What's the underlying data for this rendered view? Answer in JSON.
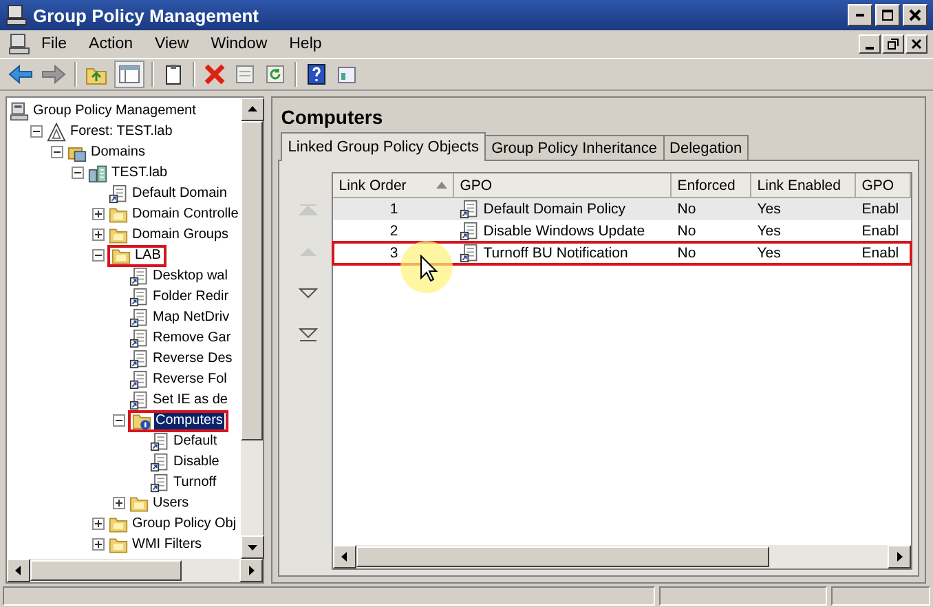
{
  "window": {
    "title": "Group Policy Management"
  },
  "menu": [
    "File",
    "Action",
    "View",
    "Window",
    "Help"
  ],
  "tree": [
    {
      "label": "Group Policy Management",
      "kind": "root",
      "selected": false,
      "highlighted": false,
      "children": [
        {
          "label": "Forest: TEST.lab",
          "kind": "forest",
          "expanded": true,
          "selected": false,
          "highlighted": false,
          "children": [
            {
              "label": "Domains",
              "kind": "domains",
              "expanded": true,
              "selected": false,
              "highlighted": false,
              "children": [
                {
                  "label": "TEST.lab",
                  "kind": "domain",
                  "expanded": true,
                  "selected": false,
                  "highlighted": false,
                  "children": [
                    {
                      "label": "Default Domain",
                      "kind": "gpo",
                      "selected": false,
                      "highlighted": false
                    },
                    {
                      "label": "Domain Controlle",
                      "kind": "folder",
                      "expanded": false,
                      "selected": false,
                      "highlighted": false
                    },
                    {
                      "label": "Domain Groups",
                      "kind": "folder",
                      "expanded": false,
                      "selected": false,
                      "highlighted": false
                    },
                    {
                      "label": "LAB",
                      "kind": "folder",
                      "expanded": true,
                      "selected": false,
                      "highlighted": true,
                      "children": [
                        {
                          "label": "Desktop wal",
                          "kind": "gpo",
                          "selected": false,
                          "highlighted": false
                        },
                        {
                          "label": "Folder Redir",
                          "kind": "gpo",
                          "selected": false,
                          "highlighted": false
                        },
                        {
                          "label": "Map NetDriv",
                          "kind": "gpo",
                          "selected": false,
                          "highlighted": false
                        },
                        {
                          "label": "Remove Gar",
                          "kind": "gpo",
                          "selected": false,
                          "highlighted": false
                        },
                        {
                          "label": "Reverse Des",
                          "kind": "gpo",
                          "selected": false,
                          "highlighted": false
                        },
                        {
                          "label": "Reverse Fol",
                          "kind": "gpo",
                          "selected": false,
                          "highlighted": false
                        },
                        {
                          "label": "Set IE as de",
                          "kind": "gpo",
                          "selected": false,
                          "highlighted": false
                        },
                        {
                          "label": "Computers",
                          "kind": "ou",
                          "expanded": true,
                          "selected": true,
                          "highlighted": true,
                          "children": [
                            {
                              "label": "Default",
                              "kind": "gpo",
                              "selected": false,
                              "highlighted": false
                            },
                            {
                              "label": "Disable",
                              "kind": "gpo",
                              "selected": false,
                              "highlighted": false
                            },
                            {
                              "label": "Turnoff",
                              "kind": "gpo",
                              "selected": false,
                              "highlighted": false
                            }
                          ]
                        },
                        {
                          "label": "Users",
                          "kind": "folder",
                          "expanded": false,
                          "selected": false,
                          "highlighted": false
                        }
                      ]
                    },
                    {
                      "label": "Group Policy Obj",
                      "kind": "folder",
                      "expanded": false,
                      "selected": false,
                      "highlighted": false
                    },
                    {
                      "label": "WMI Filters",
                      "kind": "folder",
                      "expanded": false,
                      "selected": false,
                      "highlighted": false
                    }
                  ]
                }
              ]
            }
          ]
        }
      ]
    }
  ],
  "details": {
    "title": "Computers",
    "tabs": [
      {
        "label": "Linked Group Policy Objects",
        "selected": true
      },
      {
        "label": "Group Policy Inheritance",
        "selected": false
      },
      {
        "label": "Delegation",
        "selected": false
      }
    ],
    "order_buttons": [
      {
        "kind": "top",
        "disabled": true
      },
      {
        "kind": "up",
        "disabled": true
      },
      {
        "kind": "down",
        "disabled": false
      },
      {
        "kind": "bottom",
        "disabled": false
      }
    ],
    "columns": [
      {
        "label": "Link Order",
        "sorted": true
      },
      {
        "label": "GPO",
        "sorted": false
      },
      {
        "label": "Enforced",
        "sorted": false
      },
      {
        "label": "Link Enabled",
        "sorted": false
      },
      {
        "label": "GPO",
        "sorted": false
      }
    ],
    "rows": [
      {
        "cells": [
          "1",
          "Default Domain Policy",
          "No",
          "Yes",
          "Enabl"
        ],
        "selected": true,
        "highlighted": false
      },
      {
        "cells": [
          "2",
          "Disable Windows Update",
          "No",
          "Yes",
          "Enabl"
        ],
        "selected": false,
        "highlighted": false
      },
      {
        "cells": [
          "3",
          "Turnoff BU Notification",
          "No",
          "Yes",
          "Enabl"
        ],
        "selected": false,
        "highlighted": true
      }
    ]
  }
}
